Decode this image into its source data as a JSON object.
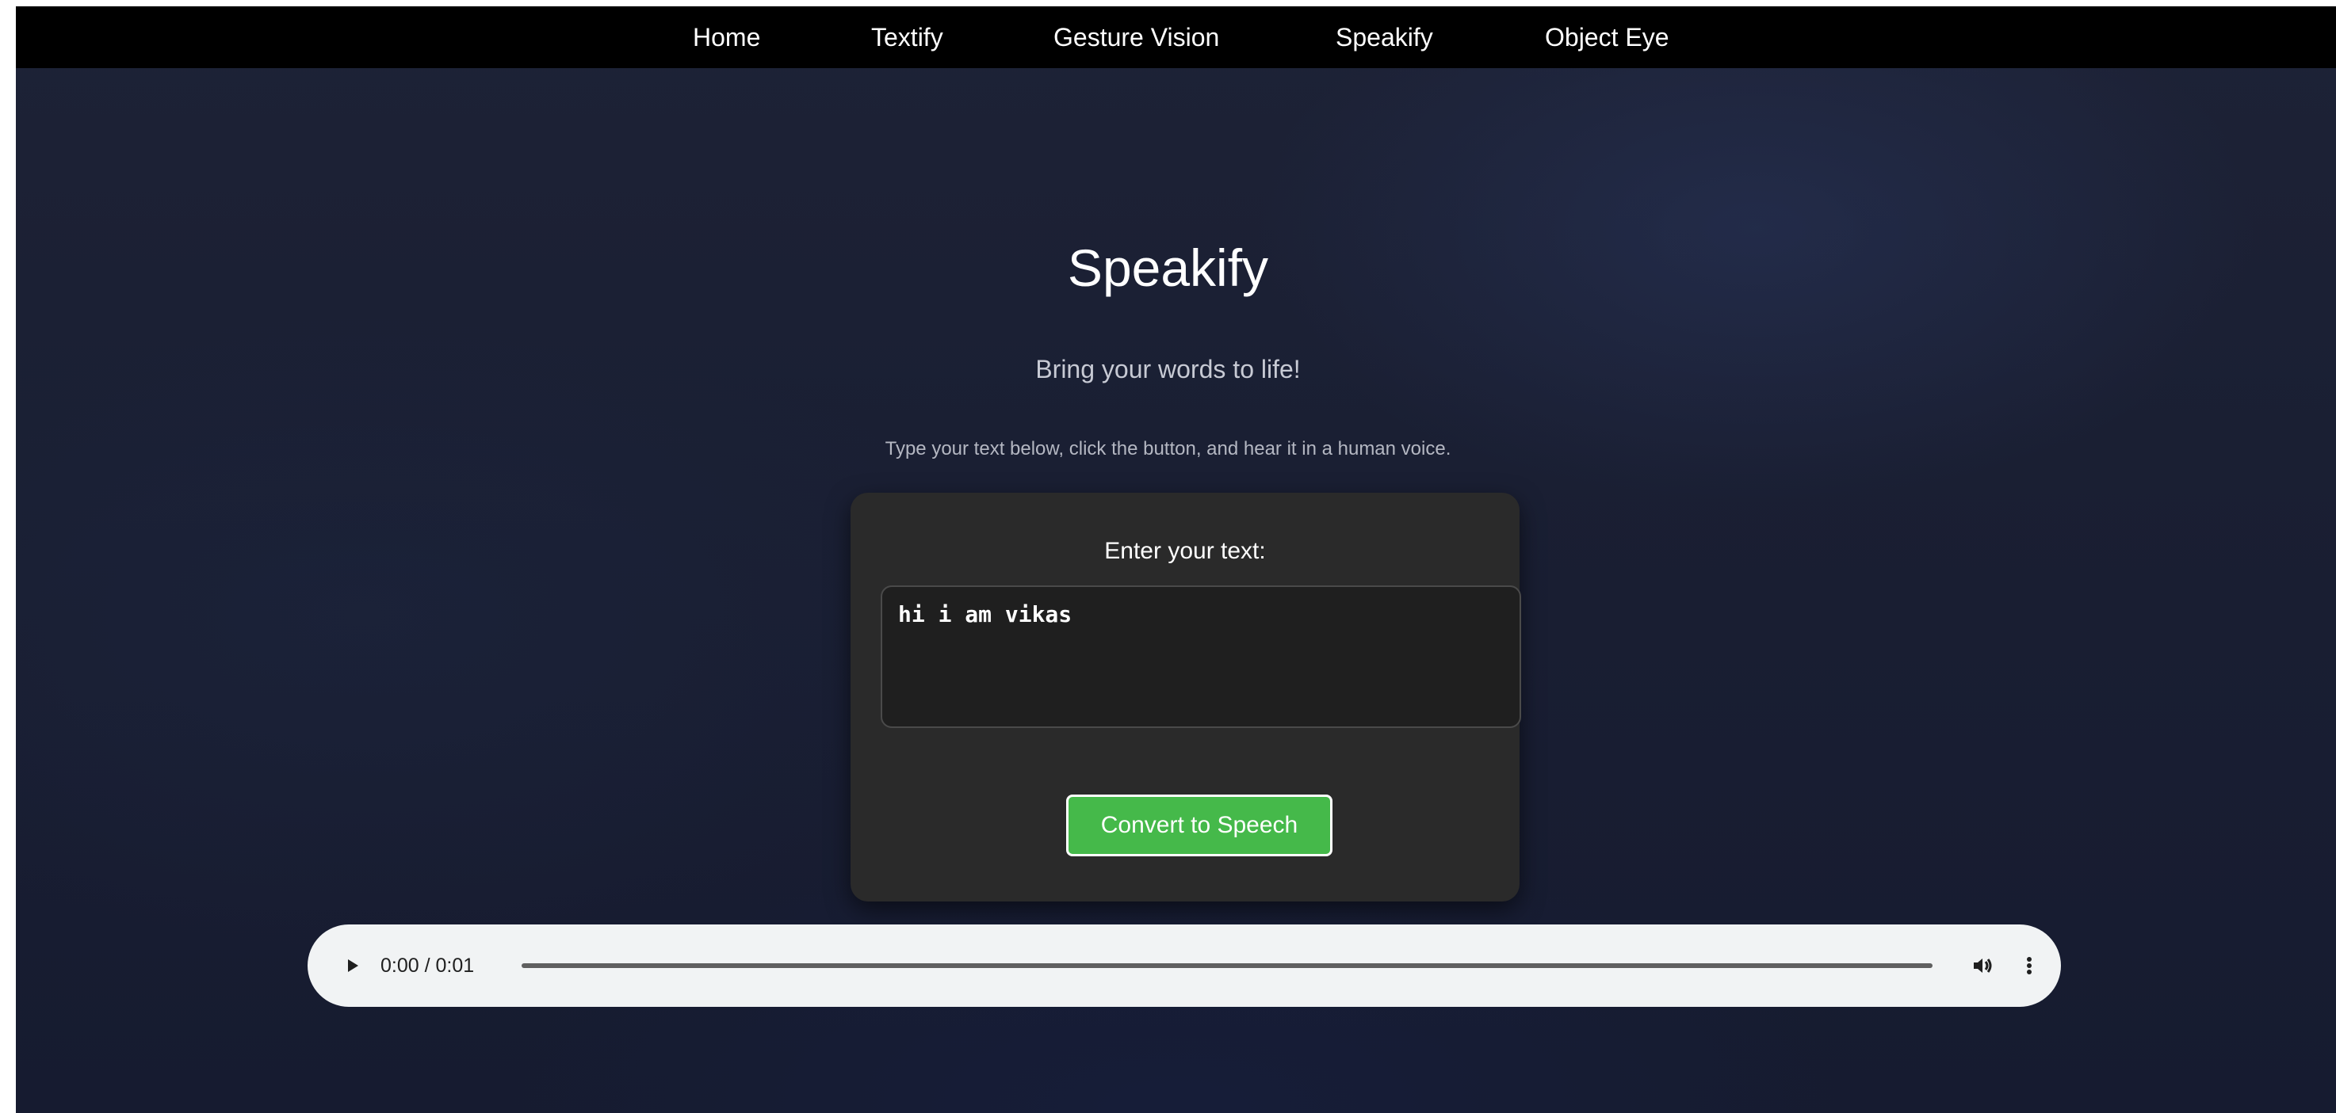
{
  "nav": {
    "items": [
      {
        "label": "Home"
      },
      {
        "label": "Textify"
      },
      {
        "label": "Gesture Vision"
      },
      {
        "label": "Speakify"
      },
      {
        "label": "Object Eye"
      }
    ]
  },
  "hero": {
    "title": "Speakify",
    "tagline": "Bring your words to life!",
    "instructions": "Type your text below, click the button, and hear it in a human voice."
  },
  "form": {
    "label": "Enter your text:",
    "text_value": "hi i am vikas",
    "button_label": "Convert to Speech"
  },
  "audio": {
    "time": "0:00 / 0:01",
    "progress": 0,
    "icons": [
      "play-icon",
      "volume-icon",
      "more-options-icon"
    ]
  },
  "colors": {
    "button": "#45b94a",
    "navbar": "#000000",
    "card": "#2a2a2a",
    "background": "#1a1f33"
  }
}
